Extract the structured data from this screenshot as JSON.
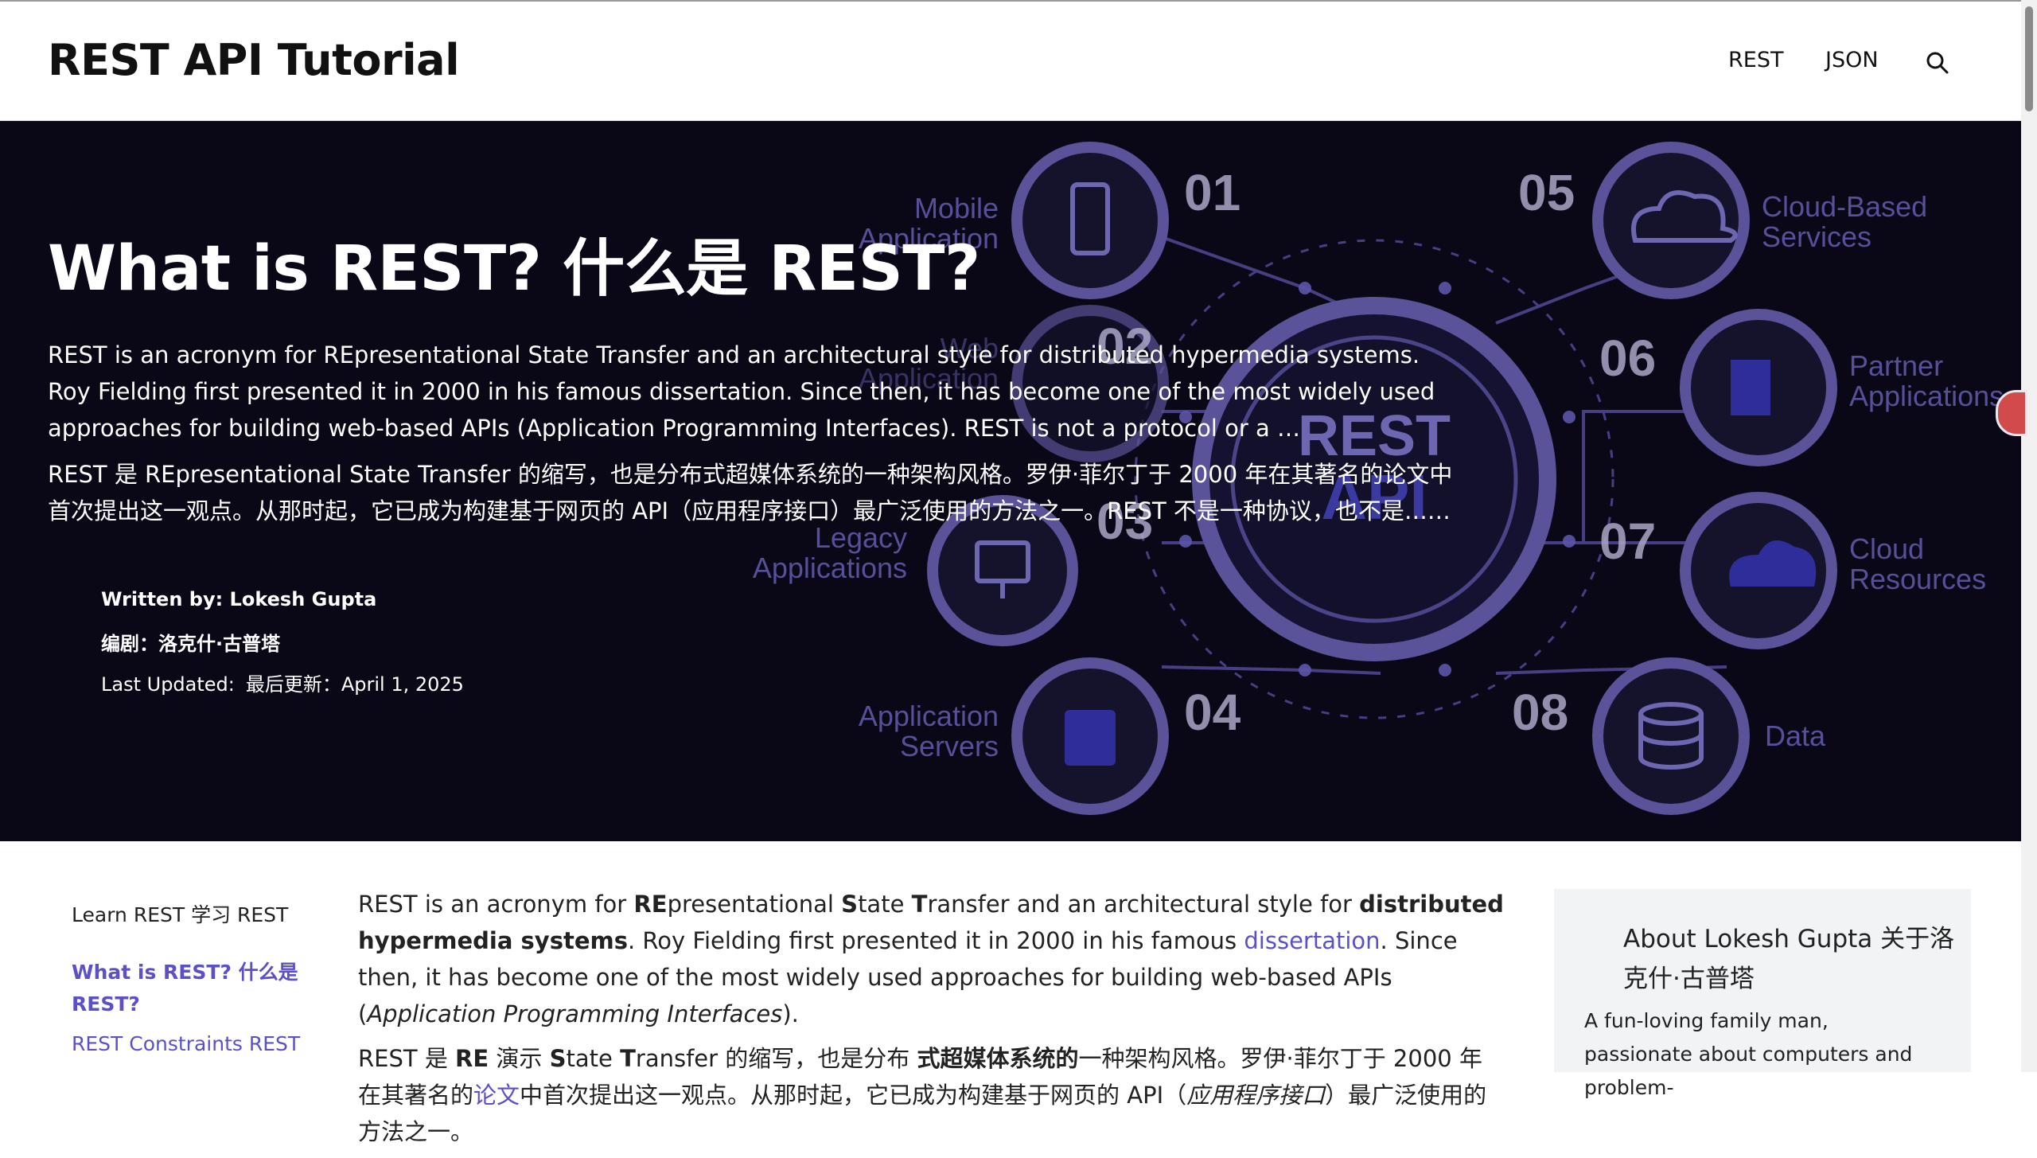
{
  "header": {
    "logo": "REST API Tutorial",
    "nav": [
      "REST",
      "JSON"
    ],
    "search_icon": "search-icon"
  },
  "hero": {
    "title": "What is REST?  什么是 REST?",
    "desc_en": "REST is an acronym for REpresentational State Transfer and an architectural style for distributed hypermedia systems. Roy Fielding first presented it in 2000 in his famous dissertation. Since then, it has become one of the most widely used approaches for building web-based APIs (Application Programming Interfaces). REST is not a protocol or a …",
    "desc_zh": "REST 是 REpresentational State Transfer 的缩写，也是分布式超媒体系统的一种架构风格。罗伊·菲尔丁于 2000 年在其著名的论文中首次提出这一观点。从那时起，它已成为构建基于网页的 API（应用程序接口）最广泛使用的方法之一。REST 不是一种协议，也不是……",
    "author_en": "Written by: Lokesh Gupta",
    "author_zh": "编剧：洛克什·古普塔",
    "updated_en": "Last Updated:",
    "updated_zh": "最后更新：April 1, 2025",
    "art": {
      "center_top": "REST",
      "center_bottom": "API",
      "nodes": [
        {
          "num": "01",
          "label": [
            "Mobile",
            "Application"
          ]
        },
        {
          "num": "02",
          "label": [
            "Web",
            "Application"
          ]
        },
        {
          "num": "03",
          "label": [
            "Legacy",
            "Applications"
          ]
        },
        {
          "num": "04",
          "label": [
            "Application",
            "Servers"
          ]
        },
        {
          "num": "05",
          "label": [
            "Cloud-Based",
            "Services"
          ]
        },
        {
          "num": "06",
          "label": [
            "Partner",
            "Applications"
          ]
        },
        {
          "num": "07",
          "label": [
            "Cloud",
            "Resources"
          ]
        },
        {
          "num": "08",
          "label": [
            "Data"
          ]
        }
      ]
    }
  },
  "sidebar": {
    "title": "Learn REST  学习 REST",
    "active": "What is REST?  什么是 REST?",
    "links": [
      "REST Constraints  REST"
    ]
  },
  "article": {
    "p1_a": "REST is an acronym for ",
    "p1_b1": "RE",
    "p1_c": "presentational ",
    "p1_b2": "S",
    "p1_d": "tate ",
    "p1_b3": "T",
    "p1_e": "ransfer and an architectural style for ",
    "p1_b4": "distributed hypermedia systems",
    "p1_f": ". Roy Fielding first presented it in 2000 in his famous ",
    "p1_link": "dissertation",
    "p1_g": ". Since then, it has become one of the most widely used approaches for building web-based APIs (",
    "p1_i": "Application Programming Interfaces",
    "p1_h": ").",
    "p2_a": "REST 是 ",
    "p2_b1": "RE",
    "p2_c": " 演示 ",
    "p2_b2": "S",
    "p2_d": "tate ",
    "p2_b3": "T",
    "p2_e": "ransfer 的缩写，也是分布 ",
    "p2_b4": "式超媒体系统的",
    "p2_f": "一种架构风格。罗伊·菲尔丁于 2000 年在其著名的",
    "p2_link": "论文",
    "p2_g": "中首次提出这一观点。从那时起，它已成为构建基于网页的 API（",
    "p2_i": "应用程序接口",
    "p2_h": "）最广泛使用的方法之一。"
  },
  "about": {
    "title": "About Lokesh Gupta  关于洛克什·古普塔",
    "text": "A fun-loving family man, passionate about computers and problem-"
  },
  "colors": {
    "accent": "#5b50c8",
    "hero_bg": "#0a0817",
    "art_stroke": "#4d4690"
  }
}
